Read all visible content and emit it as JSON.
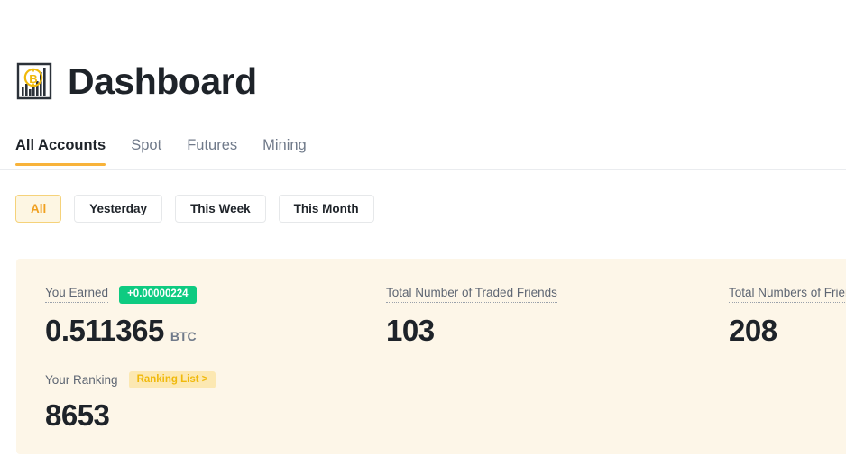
{
  "header": {
    "icon": "bitcoin-bar-chart-icon",
    "title": "Dashboard"
  },
  "tabs": [
    {
      "label": "All Accounts",
      "active": true
    },
    {
      "label": "Spot",
      "active": false
    },
    {
      "label": "Futures",
      "active": false
    },
    {
      "label": "Mining",
      "active": false
    }
  ],
  "filters": [
    {
      "label": "All",
      "active": true
    },
    {
      "label": "Yesterday",
      "active": false
    },
    {
      "label": "This Week",
      "active": false
    },
    {
      "label": "This Month",
      "active": false
    }
  ],
  "stats": {
    "earned": {
      "label": "You Earned",
      "badge": "+0.00000224",
      "value": "0.511365",
      "unit": "BTC"
    },
    "traded_friends": {
      "label": "Total Number of Traded Friends",
      "value": "103"
    },
    "total_friends": {
      "label": "Total Numbers of Friends",
      "value": "208"
    },
    "ranking": {
      "label": "Your Ranking",
      "badge": "Ranking List >",
      "value": "8653"
    }
  },
  "colors": {
    "accent_orange": "#f8b33a",
    "badge_green": "#0ecb81",
    "badge_yellow_bg": "#fce8b2",
    "badge_yellow_text": "#f0b90b",
    "card_bg": "#fdf6e8",
    "text_dark": "#1e2329",
    "text_muted": "#707a8a"
  }
}
